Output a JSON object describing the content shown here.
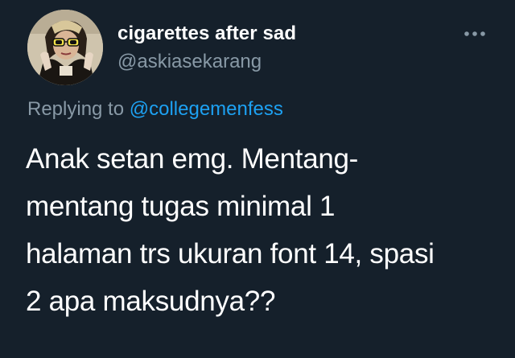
{
  "author": {
    "display_name": "cigarettes after sad",
    "username": "@askiasekarang"
  },
  "reply": {
    "prefix": "Replying to",
    "handle": "@collegemenfess"
  },
  "tweet": {
    "lines": [
      "Anak setan emg. Mentang-",
      "mentang tugas minimal 1",
      "halaman trs ukuran font 14, spasi",
      "2 apa maksudnya??"
    ]
  },
  "icons": {
    "more": "more-horizontal-icon",
    "avatar": "avatar-image"
  },
  "colors": {
    "background": "#15202b",
    "primary_text": "#ffffff",
    "secondary_text": "#8899a6",
    "link": "#1da1f2"
  }
}
